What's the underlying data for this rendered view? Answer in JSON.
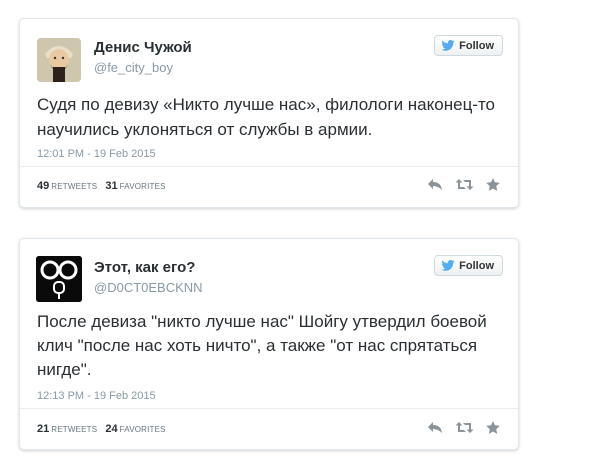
{
  "follow_label": "Follow",
  "tweets": [
    {
      "name": "Денис Чужой",
      "handle": "@fe_city_boy",
      "text": "Судя по девизу «Никто лучше нас», филологи наконец-то научились уклоняться от службы в армии.",
      "time": "12:01 PM - 19 Feb 2015",
      "retweets": "49",
      "retweets_label": "RETWEETS",
      "favorites": "31",
      "favorites_label": "FAVORITES"
    },
    {
      "name": "Этот, как его?",
      "handle": "@D0CT0EBCKNN",
      "text": "После девиза \"никто лучше нас\" Шойгу утвердил боевой клич \"после нас хоть ничто\", а также  \"от нас спрятаться нигде\".",
      "time": "12:13 PM - 19 Feb 2015",
      "retweets": "21",
      "retweets_label": "RETWEETS",
      "favorites": "24",
      "favorites_label": "FAVORITES"
    }
  ],
  "colors": {
    "twitter_blue": "#55acee",
    "muted": "#8899a6",
    "icon": "#8a9399"
  }
}
